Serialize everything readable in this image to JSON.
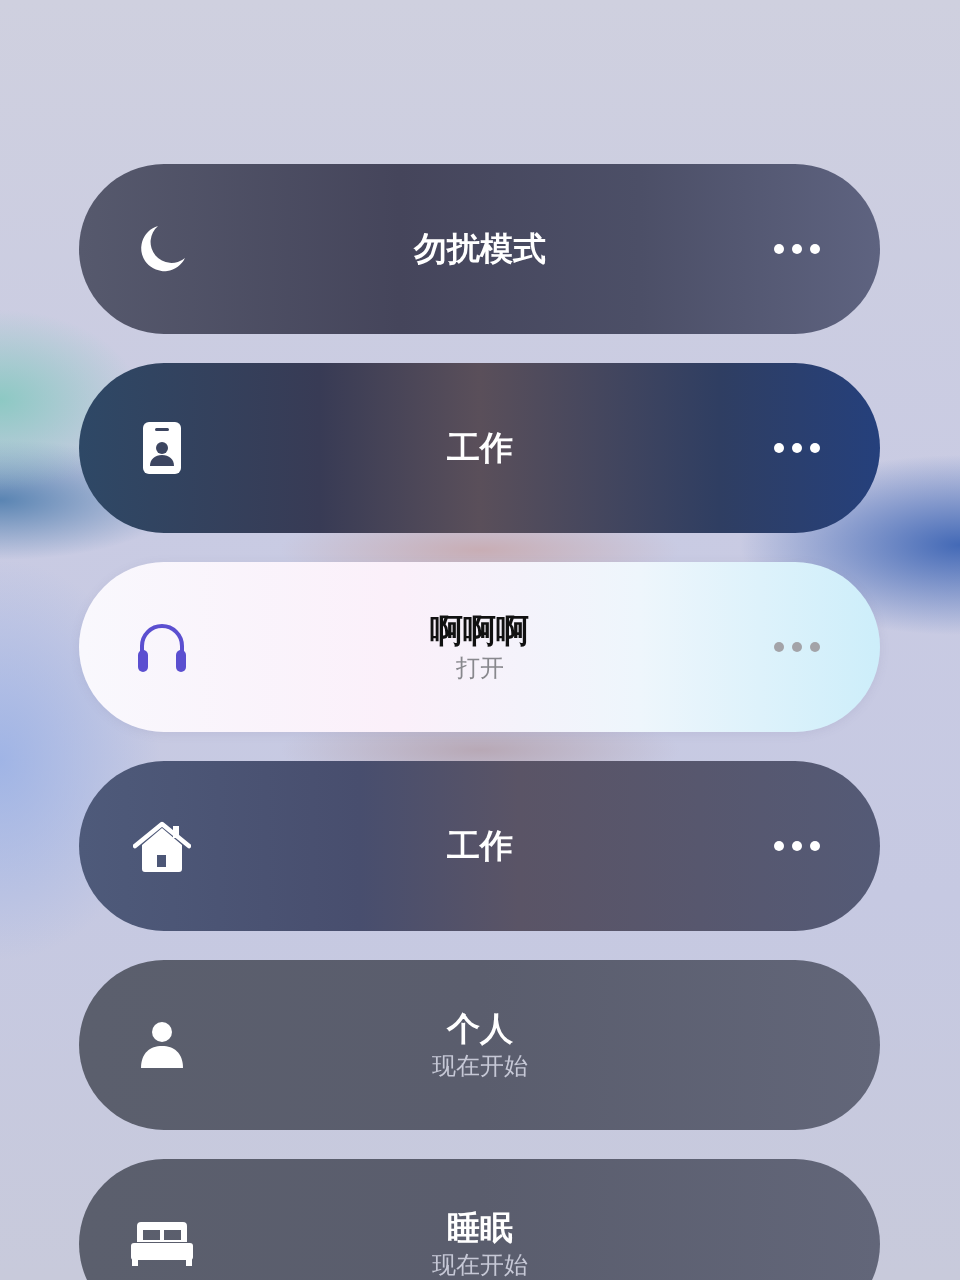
{
  "modes": [
    {
      "title": "勿扰模式",
      "selected": false,
      "more_button": true
    },
    {
      "title": "工作",
      "selected": false,
      "more_button": true
    },
    {
      "title": "啊啊啊",
      "status": "打开",
      "selected": true,
      "more_button": true
    },
    {
      "title": "工作",
      "selected": false,
      "more_button": true
    },
    {
      "title": "个人",
      "status": "现在开始",
      "selected": false,
      "more_button": false
    },
    {
      "title": "睡眠",
      "status": "现在开始",
      "selected": false,
      "more_button": false
    }
  ]
}
